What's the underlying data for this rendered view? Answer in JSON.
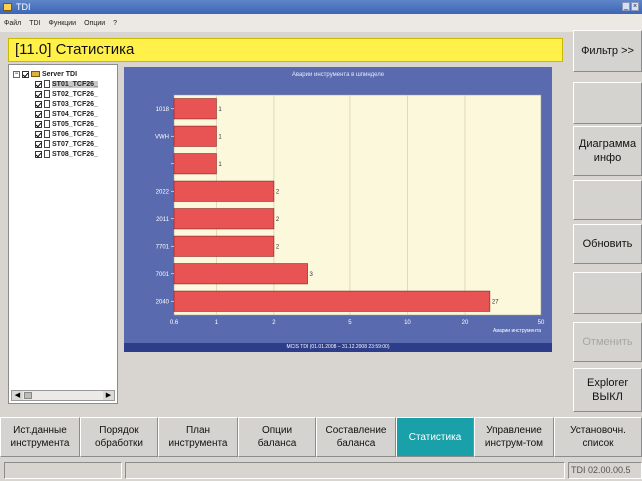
{
  "window": {
    "title": "TDI"
  },
  "menu": [
    "Файл",
    "TDI",
    "Функции",
    "Опции",
    "?"
  ],
  "header": {
    "title": "[11.0] Статистика"
  },
  "tree": {
    "root": "Server TDI",
    "items": [
      "ST01_TCF26_",
      "ST02_TCF26_",
      "ST03_TCF26_",
      "ST04_TCF26_",
      "ST05_TCF26_",
      "ST06_TCF26_",
      "ST07_TCF26_",
      "ST08_TCF26_"
    ]
  },
  "right_buttons": [
    {
      "label": "Фильтр >>",
      "enabled": true
    },
    {
      "label": "",
      "enabled": true
    },
    {
      "label": "Диаграмма\nинфо",
      "enabled": true
    },
    {
      "label": "",
      "enabled": true
    },
    {
      "label": "Обновить",
      "enabled": true
    },
    {
      "label": "",
      "enabled": true
    },
    {
      "label": "Отменить",
      "enabled": false
    },
    {
      "label": "Explorer\nВЫКЛ",
      "enabled": true
    }
  ],
  "tabs": [
    {
      "label": "Ист.данные\nинструмента",
      "active": false
    },
    {
      "label": "Порядок\nобработки",
      "active": false
    },
    {
      "label": "План\nинструмента",
      "active": false
    },
    {
      "label": "Опции\nбаланса",
      "active": false
    },
    {
      "label": "Составление\nбаланса",
      "active": false
    },
    {
      "label": "Статистика",
      "active": true
    },
    {
      "label": "Управление\nинструм-том",
      "active": false
    },
    {
      "label": "Установочн.\nсписок",
      "active": false
    }
  ],
  "status": {
    "left": "",
    "middle": "",
    "right": "TDI 02.00.00.5"
  },
  "chart_data": {
    "type": "bar",
    "orientation": "horizontal",
    "title": "Аварии инструмента в шпинделе",
    "xlabel": "Аварии инструмента",
    "footer": "MCIS TDI (01.01.2008 – 31.12.2008 23:59:00)",
    "xscale": "log",
    "xlim": [
      0.6,
      50
    ],
    "xticks": [
      "0.6",
      "1",
      "2",
      "5",
      "10",
      "20",
      "50"
    ],
    "categories": [
      "1018",
      "VWH",
      "",
      "2022",
      "2011",
      "7701",
      "7001",
      "2040"
    ],
    "values": [
      1,
      1,
      1,
      2,
      2,
      2,
      3,
      27
    ],
    "bar_color": "#e85353",
    "plot_bg": "#fbf8dc",
    "grid": true
  }
}
